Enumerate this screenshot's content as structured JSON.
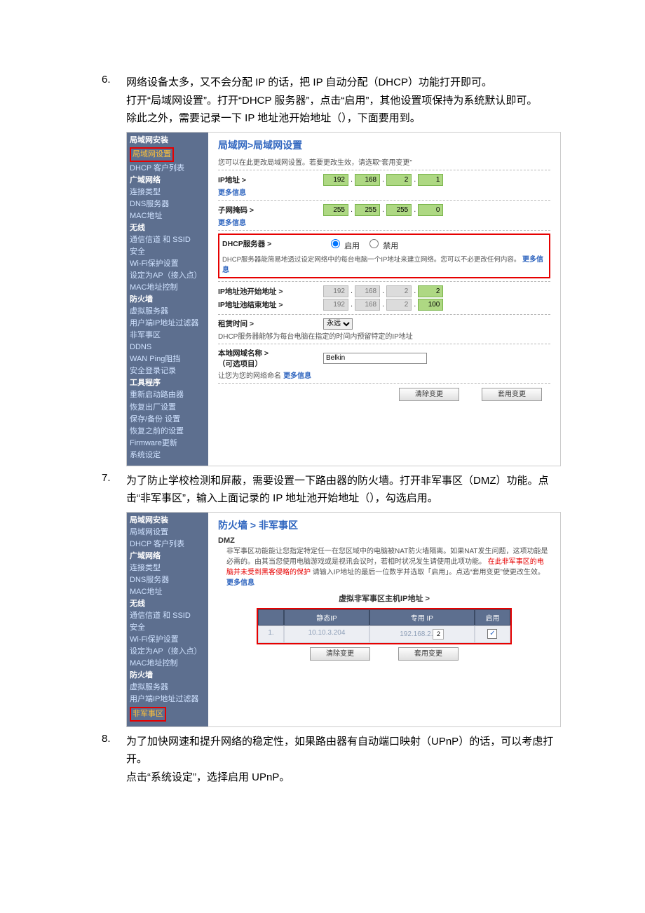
{
  "items": [
    {
      "num": "6.",
      "para": "网络设备太多，又不会分配 IP 的话，把 IP 自动分配（DHCP）功能打开即可。\n打开“局域网设置”。打开“DHCP 服务器”，点击“启用”，其他设置项保持为系统默认即可。\n除此之外，需要记录一下 IP 地址池开始地址（），下面要用到。"
    },
    {
      "num": "7.",
      "para": "为了防止学校检测和屏蔽，需要设置一下路由器的防火墙。打开非军事区（DMZ）功能。点击“非军事区”，输入上面记录的 IP 地址池开始地址（），勾选启用。"
    },
    {
      "num": "8.",
      "para": "为了加快网速和提升网络的稳定性，如果路由器有自动端口映射（UPnP）的话，可以考虑打开。\n点击“系统设定”，选择启用 UPnP。"
    }
  ],
  "shot1": {
    "sidebar": {
      "cat1": "局域网安装",
      "cat1_items": [
        "局域网设置",
        "DHCP 客户列表"
      ],
      "cat2": "广域网络",
      "cat2_items": [
        "连接类型",
        "DNS服务器",
        "MAC地址"
      ],
      "cat3": "无线",
      "cat3_items": [
        "通信信道 和 SSID",
        "安全",
        "Wi-Fi保护设置",
        "设定为AP（接入点）",
        "MAC地址控制"
      ],
      "cat4": "防火墙",
      "cat4_items": [
        "虚拟服务器",
        "用户端IP地址过滤器",
        "非军事区",
        "DDNS",
        "WAN Ping阻挡",
        "安全登录记录"
      ],
      "cat5": "工具程序",
      "cat5_items": [
        "重新启动路由器",
        "恢复出厂设置",
        "保存/备份 设置",
        "恢复之前的设置",
        "Firmware更新",
        "系统设定"
      ]
    },
    "title": "局域网>局域网设置",
    "desc": "您可以在此更改局域网设置。若要更改生效，请选取“套用变更”",
    "ip_label": "IP地址 >",
    "more": "更多信息",
    "ip": [
      "192",
      "168",
      "2",
      "1"
    ],
    "mask_label": "子网掩码 >",
    "mask": [
      "255",
      "255",
      "255",
      "0"
    ],
    "dhcp_label": "DHCP服务器 >",
    "enable": "启用",
    "disable": "禁用",
    "dhcp_desc": "DHCP服务器能简易地透过设定网络中的每台电脑一个IP地址来建立网络。您可以不必更改任何内容。",
    "pool_start_label": "IP地址池开始地址 >",
    "pool_start": [
      "192",
      "168",
      "2",
      "2"
    ],
    "pool_end_label": "IP地址池结束地址 >",
    "pool_end": [
      "192",
      "168",
      "2",
      "100"
    ],
    "lease_label": "租赁时间 >",
    "lease_value": "永远",
    "lease_desc": "DHCP服务器能够为每台电脑在指定的时间内预留特定的IP地址",
    "local_label": "本地网域名称 >",
    "local_sub": "（可选项目）",
    "local_value": "Belkin",
    "local_desc": "让您为您的网络命名",
    "btn_clear": "清除变更",
    "btn_apply": "套用变更"
  },
  "shot2": {
    "sidebar": {
      "cat1": "局域网安装",
      "cat1_items": [
        "局域网设置",
        "DHCP 客户列表"
      ],
      "cat2": "广域网络",
      "cat2_items": [
        "连接类型",
        "DNS服务器",
        "MAC地址"
      ],
      "cat3": "无线",
      "cat3_items": [
        "通信信道 和 SSID",
        "安全",
        "Wi-Fi保护设置",
        "设定为AP（接入点）",
        "MAC地址控制"
      ],
      "cat4": "防火墙",
      "cat4_items": [
        "虚拟服务器",
        "用户端IP地址过滤器",
        "非军事区"
      ]
    },
    "title": "防火墙 > 非军事区",
    "dmz_head": "DMZ",
    "dmz_desc1": "非军事区功能能让您指定特定任一在您区域中的电脑被NAT防火墙隔离。如果NAT发生问题，这项功能是必需的。由其当您使用电脑游戏或是视讯会议时，若相时状况发生请使用此项功能。",
    "dmz_desc_red": "在此非军事区的电脑并未受到黑客侵略的保护",
    "dmz_desc2": "  请输入IP地址的最后一位数字并选取「启用」。点选“套用变更”使更改生效。",
    "more": "更多信息",
    "tbl_title": "虚拟非军事区主机IP地址 >",
    "col_idx": "",
    "col_static": "静态IP",
    "col_private": "专用 IP",
    "col_enable": "启用",
    "row_idx": "1.",
    "row_static": "10.10.3.204",
    "row_private_prefix": "192.168.2.",
    "row_private_suffix": "2",
    "btn_clear": "清除变更",
    "btn_apply": "套用变更"
  }
}
